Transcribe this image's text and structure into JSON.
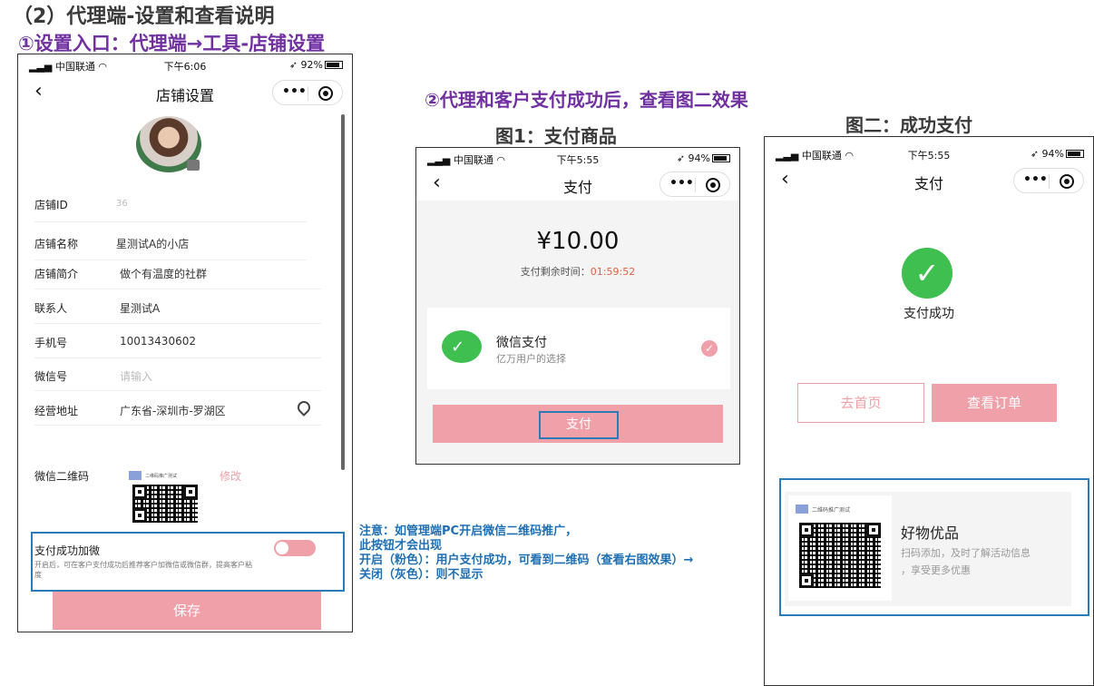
{
  "headings": {
    "main": "（2）代理端-设置和查看说明",
    "step1": "①设置入口：代理端→工具-店铺设置",
    "step2": "②代理和客户支付成功后，查看图二效果",
    "fig1": "图1：支付商品",
    "fig2": "图二：成功支付"
  },
  "phone1": {
    "status": {
      "carrier": "中国联通",
      "time": "下午6:06",
      "battery": "92%"
    },
    "nav_title": "店铺设置",
    "fields": [
      {
        "label": "店铺ID",
        "value": "36"
      },
      {
        "label": "店铺名称",
        "value": "星测试A的小店"
      },
      {
        "label": "店铺简介",
        "value": "做个有温度的社群"
      },
      {
        "label": "联系人",
        "value": "星测试A"
      },
      {
        "label": "手机号",
        "value": "10013430602"
      },
      {
        "label": "微信号",
        "placeholder": "请输入"
      },
      {
        "label": "经营地址",
        "value": "广东省-深圳市-罗湖区"
      }
    ],
    "qr_label": "微信二维码",
    "qr_mini_title": "二维码推广测试",
    "qr_edit": "修改",
    "toggle_label": "支付成功加微",
    "toggle_desc": "开启后，可在客户支付成功后推荐客户加微信或微信群，提高客户粘度",
    "save_label": "保存"
  },
  "note": {
    "line1": "注意：如管理端PC开启微信二维码推广，",
    "line2": "此按钮才会出现",
    "line3": "开启（粉色）：用户支付成功，可看到二维码（查看右图效果）→",
    "line4": "关闭（灰色）：则不显示"
  },
  "phone2": {
    "status": {
      "carrier": "中国联通",
      "time": "下午5:55",
      "battery": "94%"
    },
    "nav_title": "支付",
    "amount": "¥10.00",
    "timer_label": "支付剩余时间：",
    "timer_value": "01:59:52",
    "method_name": "微信支付",
    "method_desc": "亿万用户的选择",
    "pay_label": "支付"
  },
  "phone3": {
    "status": {
      "carrier": "中国联通",
      "time": "下午5:55",
      "battery": "94%"
    },
    "nav_title": "支付",
    "success_text": "支付成功",
    "home_label": "去首页",
    "order_label": "查看订单",
    "promo_mini_title": "二维码推广测试",
    "promo_title": "好物优品",
    "promo_desc1": "扫码添加，及时了解活动信息",
    "promo_desc2": "，享受更多优惠"
  },
  "colors": {
    "accent_pink": "#f0a0a8",
    "success_green": "#3fbf4f",
    "note_blue": "#1f6fb3",
    "heading_purple": "#7030a0",
    "timer_red": "#e06040"
  }
}
